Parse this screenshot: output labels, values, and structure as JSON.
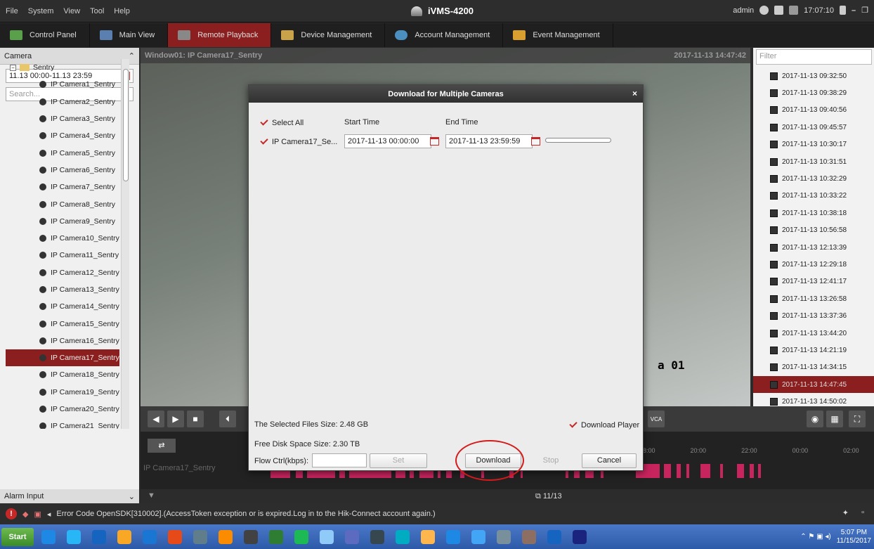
{
  "menubar": {
    "items": [
      "File",
      "System",
      "View",
      "Tool",
      "Help"
    ]
  },
  "app": {
    "title": "iVMS-4200"
  },
  "header_right": {
    "user": "admin",
    "time": "17:07:10"
  },
  "tabs": [
    {
      "label": "Control Panel",
      "color": "#5aa04a"
    },
    {
      "label": "Main View",
      "color": "#5a7fb0"
    },
    {
      "label": "Remote Playback",
      "color": "#888888"
    },
    {
      "label": "Device Management",
      "color": "#c9a24a"
    },
    {
      "label": "Account Management",
      "color": "#4a8fc0"
    },
    {
      "label": "Event Management",
      "color": "#d9a030"
    }
  ],
  "active_tab": "Remote Playback",
  "left": {
    "header": "Camera",
    "date_range": "11.13 00:00-11.13 23:59",
    "search_placeholder": "Search...",
    "root": "Sentry",
    "cameras": [
      "IP Camera1_Sentry",
      "IP Camera2_Sentry",
      "IP Camera3_Sentry",
      "IP Camera4_Sentry",
      "IP Camera5_Sentry",
      "IP Camera6_Sentry",
      "IP Camera7_Sentry",
      "IP Camera8_Sentry",
      "IP Camera9_Sentry",
      "IP Camera10_Sentry",
      "IP Camera11_Sentry",
      "IP Camera12_Sentry",
      "IP Camera13_Sentry",
      "IP Camera14_Sentry",
      "IP Camera15_Sentry",
      "IP Camera16_Sentry",
      "IP Camera17_Sentry",
      "IP Camera18_Sentry",
      "IP Camera19_Sentry",
      "IP Camera20_Sentry",
      "IP Camera21_Sentry"
    ],
    "selected_camera": "IP Camera17_Sentry",
    "alarm_label": "Alarm Input"
  },
  "video": {
    "window_title": "Window01: IP Camera17_Sentry",
    "timestamp": "2017-11-13 14:47:42",
    "osd_text": "a 01",
    "timeline_camera": "IP Camera17_Sentry",
    "page_count": "11/13"
  },
  "right": {
    "filter_placeholder": "Filter",
    "recordings": [
      "2017-11-13 09:32:50",
      "2017-11-13 09:38:29",
      "2017-11-13 09:40:56",
      "2017-11-13 09:45:57",
      "2017-11-13 10:30:17",
      "2017-11-13 10:31:51",
      "2017-11-13 10:32:29",
      "2017-11-13 10:33:22",
      "2017-11-13 10:38:18",
      "2017-11-13 10:56:58",
      "2017-11-13 12:13:39",
      "2017-11-13 12:29:18",
      "2017-11-13 12:41:17",
      "2017-11-13 13:26:58",
      "2017-11-13 13:37:36",
      "2017-11-13 13:44:20",
      "2017-11-13 14:21:19",
      "2017-11-13 14:34:15",
      "2017-11-13 14:47:45",
      "2017-11-13 14:50:02"
    ],
    "selected": "2017-11-13 14:47:45"
  },
  "timeline": {
    "ticks": [
      "18:00",
      "20:00",
      "22:00",
      "00:00",
      "02:00"
    ]
  },
  "dialog": {
    "title": "Download for Multiple Cameras",
    "select_all": "Select All",
    "col_start": "Start Time",
    "col_end": "End Time",
    "camera": "IP Camera17_Se...",
    "start_time": "2017-11-13 00:00:00",
    "end_time": "2017-11-13 23:59:59",
    "selected_size": "The Selected Files Size: 2.48 GB",
    "free_space": "Free Disk Space Size: 2.30 TB",
    "download_player": "Download Player",
    "flow_label": "Flow Ctrl(kbps):",
    "buttons": {
      "set": "Set",
      "download": "Download",
      "stop": "Stop",
      "cancel": "Cancel"
    }
  },
  "status": {
    "message": "Error Code OpenSDK[310002].(AccessToken exception or is expired.Log in to the Hik-Connect account again.)"
  },
  "taskbar": {
    "start": "Start",
    "time": "5:07 PM",
    "date": "11/15/2017",
    "apps": [
      "#1e88e5",
      "#29b6f6",
      "#1565c0",
      "#f9a825",
      "#1976d2",
      "#e64a19",
      "#607d8b",
      "#fb8c00",
      "#424242",
      "#2e7d32",
      "#1db954",
      "#90caf9",
      "#5c6bc0",
      "#37474f",
      "#00acc1",
      "#ffb74d",
      "#1e88e5",
      "#42a5f5",
      "#78909c",
      "#8d6e63",
      "#1565c0",
      "#1a237e"
    ]
  }
}
